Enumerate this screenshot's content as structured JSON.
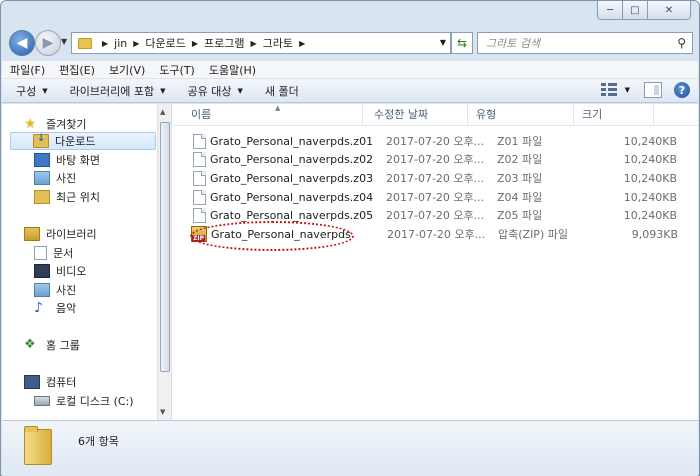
{
  "window": {
    "caption": {
      "minimize": "─",
      "maximize": "□",
      "close": "✕"
    }
  },
  "nav": {
    "back": "◀",
    "forward": "▶",
    "breadcrumbs": [
      "jin",
      "다운로드",
      "프로그램",
      "그라토"
    ],
    "search_placeholder": "그라토 검색"
  },
  "menu": [
    "파일(F)",
    "편집(E)",
    "보기(V)",
    "도구(T)",
    "도움말(H)"
  ],
  "toolbar": {
    "organize": "구성",
    "include_library": "라이브러리에 포함",
    "share_with": "공유 대상",
    "new_folder": "새 폴더"
  },
  "sidebar": {
    "favorites": {
      "label": "즐겨찾기",
      "icon": "star-icon"
    },
    "favorites_items": [
      {
        "label": "다운로드",
        "icon": "downloads-folder-icon",
        "selected": true
      },
      {
        "label": "바탕 화면",
        "icon": "desktop-icon"
      },
      {
        "label": "사진",
        "icon": "pictures-icon"
      },
      {
        "label": "최근 위치",
        "icon": "recent-places-icon"
      }
    ],
    "libraries": {
      "label": "라이브러리",
      "icon": "library-icon"
    },
    "library_items": [
      {
        "label": "문서",
        "icon": "documents-icon"
      },
      {
        "label": "비디오",
        "icon": "videos-icon"
      },
      {
        "label": "사진",
        "icon": "pictures-icon"
      },
      {
        "label": "음악",
        "icon": "music-icon"
      }
    ],
    "homegroup": {
      "label": "홈 그룹",
      "icon": "homegroup-icon"
    },
    "computer": {
      "label": "컴퓨터",
      "icon": "computer-icon"
    },
    "computer_items": [
      {
        "label": "로컬 디스크 (C:)",
        "icon": "drive-icon"
      }
    ]
  },
  "columns": {
    "name": "이름",
    "modified": "수정한 날짜",
    "type": "유형",
    "size": "크기"
  },
  "files": [
    {
      "name": "Grato_Personal_naverpds.z01",
      "modified": "2017-07-20 오후...",
      "type": "Z01 파일",
      "size": "10,240KB",
      "icon": "file-icon"
    },
    {
      "name": "Grato_Personal_naverpds.z02",
      "modified": "2017-07-20 오후...",
      "type": "Z02 파일",
      "size": "10,240KB",
      "icon": "file-icon"
    },
    {
      "name": "Grato_Personal_naverpds.z03",
      "modified": "2017-07-20 오후...",
      "type": "Z03 파일",
      "size": "10,240KB",
      "icon": "file-icon"
    },
    {
      "name": "Grato_Personal_naverpds.z04",
      "modified": "2017-07-20 오후...",
      "type": "Z04 파일",
      "size": "10,240KB",
      "icon": "file-icon"
    },
    {
      "name": "Grato_Personal_naverpds.z05",
      "modified": "2017-07-20 오후...",
      "type": "Z05 파일",
      "size": "10,240KB",
      "icon": "file-icon"
    },
    {
      "name": "Grato_Personal_naverpds",
      "modified": "2017-07-20 오후...",
      "type": "압축(ZIP) 파일",
      "size": "9,093KB",
      "icon": "zip-archive-icon",
      "highlighted": true
    }
  ],
  "zip_badge": "ZIP",
  "details": {
    "item_count": "6개 항목"
  },
  "colors": {
    "highlight": "#c01717",
    "chrome": "#d9e4f1",
    "selection": "#d5e8fb"
  }
}
